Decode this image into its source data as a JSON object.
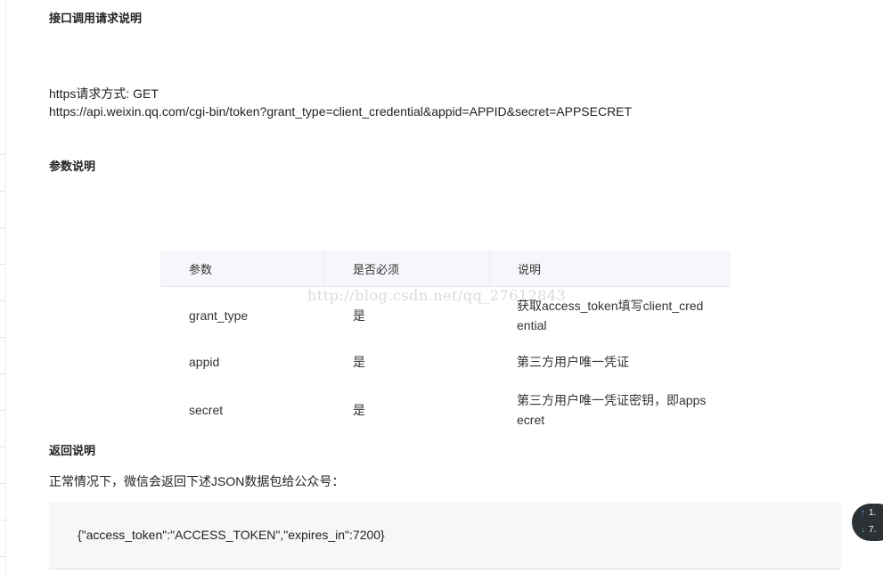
{
  "headings": {
    "api_call": "接口调用请求说明",
    "params": "参数说明",
    "return": "返回说明"
  },
  "request": {
    "method_line": "https请求方式: GET",
    "url_line": "https://api.weixin.qq.com/cgi-bin/token?grant_type=client_credential&appid=APPID&secret=APPSECRET"
  },
  "table": {
    "headers": [
      "参数",
      "是否必须",
      "说明"
    ],
    "rows": [
      {
        "param": "grant_type",
        "required": "是",
        "desc": "获取access_token填写client_credential"
      },
      {
        "param": "appid",
        "required": "是",
        "desc": "第三方用户唯一凭证"
      },
      {
        "param": "secret",
        "required": "是",
        "desc": "第三方用户唯一凭证密钥，即appsecret"
      }
    ]
  },
  "watermark": "http://blog.csdn.net/qq_27612843",
  "return_desc": "正常情况下，微信会返回下述JSON数据包给公众号：",
  "code_sample": "{\"access_token\":\"ACCESS_TOKEN\",\"expires_in\":7200}",
  "speed_widget": {
    "up": "1.",
    "down": "7."
  }
}
